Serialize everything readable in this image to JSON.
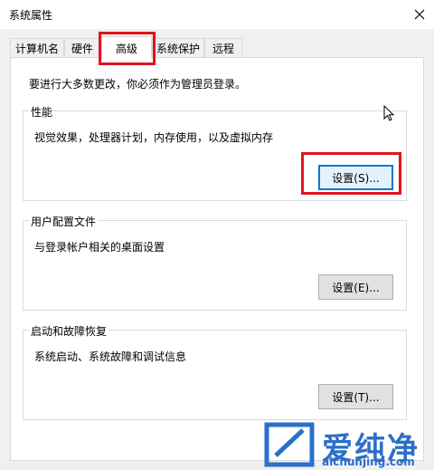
{
  "window": {
    "title": "系统属性"
  },
  "tabs": [
    {
      "label": "计算机名"
    },
    {
      "label": "硬件"
    },
    {
      "label": "高级",
      "active": true
    },
    {
      "label": "系统保护"
    },
    {
      "label": "远程"
    }
  ],
  "notice": "要进行大多数更改，你必须作为管理员登录。",
  "groups": {
    "performance": {
      "title": "性能",
      "desc": "视觉效果，处理器计划，内存使用，以及虚拟内存",
      "button": "设置(S)..."
    },
    "profiles": {
      "title": "用户配置文件",
      "desc": "与登录帐户相关的桌面设置",
      "button": "设置(E)..."
    },
    "startup": {
      "title": "启动和故障恢复",
      "desc": "系统启动、系统故障和调试信息",
      "button": "设置(T)..."
    }
  },
  "watermark": {
    "text": "爱纯净",
    "url": "aichunjing.com"
  },
  "colors": {
    "highlight": "#e0141e",
    "accent": "#0078d7",
    "watermark": "#2a6fc9"
  }
}
